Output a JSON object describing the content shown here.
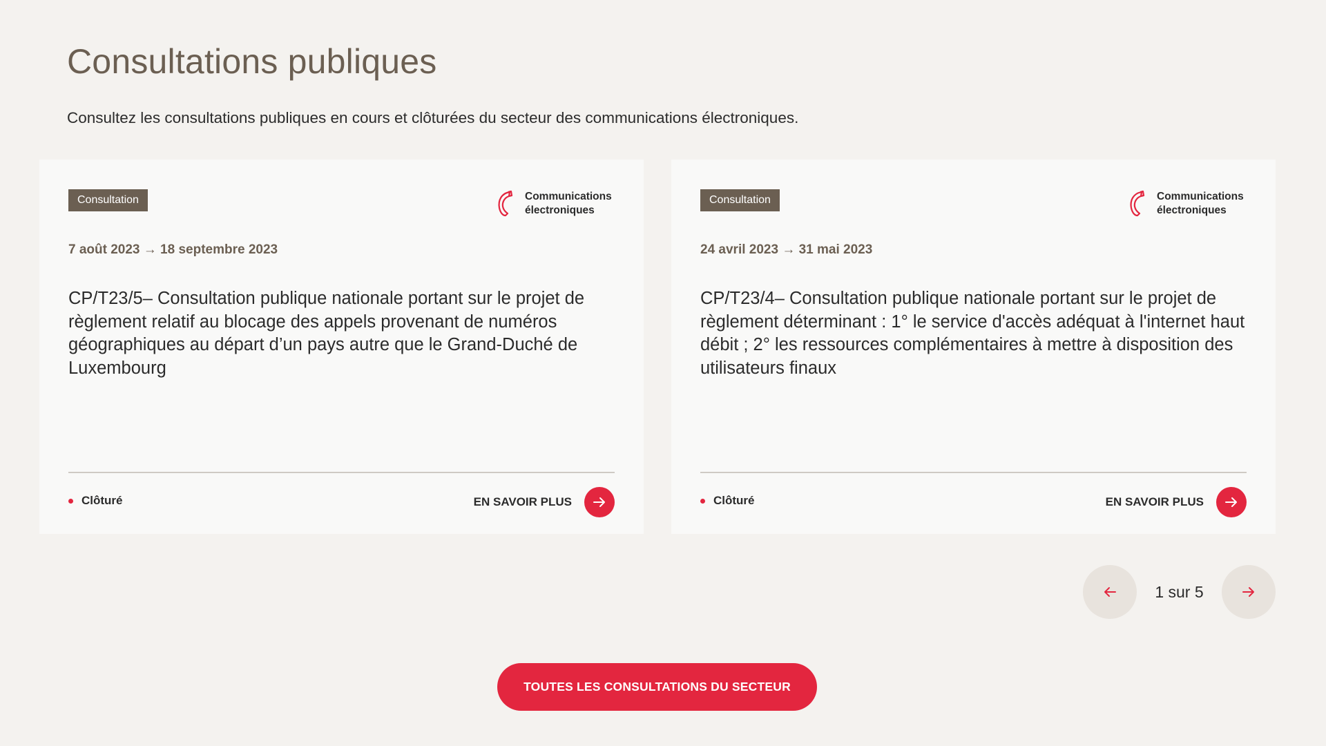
{
  "header": {
    "title": "Consultations publiques",
    "subtitle": "Consultez les consultations publiques en cours et clôturées du secteur des communications électroniques."
  },
  "cards": [
    {
      "badge": "Consultation",
      "sector_line1": "Communications",
      "sector_line2": "électroniques",
      "sector_icon": "telephone-handset-icon",
      "dates": "7 août 2023 → 18 septembre 2023",
      "title": "CP/T23/5– Consultation publique nationale portant sur le projet de règlement relatif au blocage des appels provenant de numéros géographiques au départ d’un pays autre que le Grand-Duché de Luxembourg",
      "status": "Clôturé",
      "link_label": "EN SAVOIR PLUS"
    },
    {
      "badge": "Consultation",
      "sector_line1": "Communications",
      "sector_line2": "électroniques",
      "sector_icon": "telephone-handset-icon",
      "dates": "24 avril 2023 → 31 mai 2023",
      "title": "CP/T23/4– Consultation publique nationale portant sur le projet de règlement déterminant : 1° le service d'accès adéquat à l'internet haut débit ; 2° les ressources complémentaires à mettre à disposition des utilisateurs finaux",
      "status": "Clôturé",
      "link_label": "EN SAVOIR PLUS"
    }
  ],
  "pagination": {
    "label": "1 sur 5",
    "current": 1,
    "total": 5
  },
  "cta": {
    "label": "TOUTES LES CONSULTATIONS DU SECTEUR"
  },
  "colors": {
    "background": "#f4f2ef",
    "card": "#f9f9f8",
    "accent": "#e3263f",
    "brown": "#6b5f52",
    "pager_button": "#e8e3dd"
  }
}
